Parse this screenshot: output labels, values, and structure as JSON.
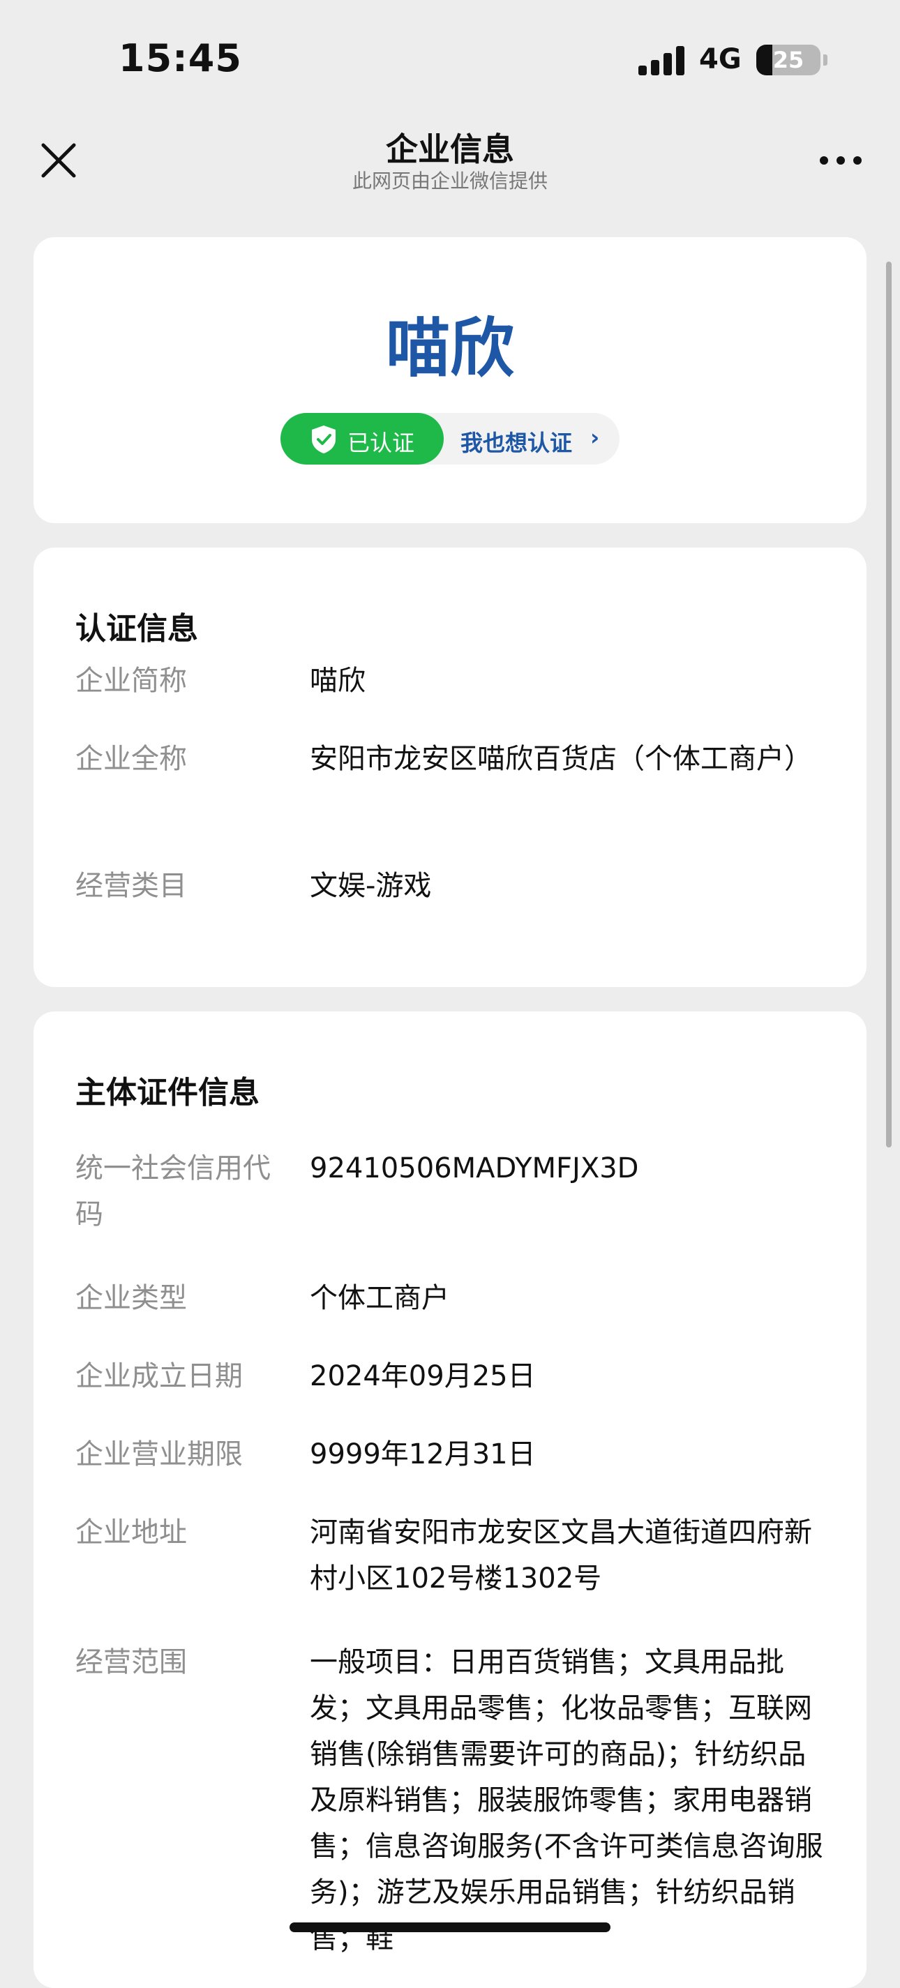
{
  "status": {
    "time": "15:45",
    "network": "4G",
    "battery": "25",
    "battery_level": 0.25
  },
  "nav": {
    "title": "企业信息",
    "subtitle": "此网页由企业微信提供"
  },
  "header_card": {
    "name": "喵欣",
    "badge": "已认证",
    "link": "我也想认证",
    "link_chevron": "›"
  },
  "cert_info": {
    "title": "认证信息",
    "rows": [
      {
        "label": "企业简称",
        "value": "喵欣"
      },
      {
        "label": "企业全称",
        "value": "安阳市龙安区喵欣百货店（个体工商户）"
      },
      {
        "label": "经营类目",
        "value": "文娱-游戏"
      }
    ]
  },
  "entity_info": {
    "title": "主体证件信息",
    "rows": [
      {
        "label": "统一社会信用代码",
        "value": "92410506MADYMFJX3D"
      },
      {
        "label": "企业类型",
        "value": "个体工商户"
      },
      {
        "label": "企业成立日期",
        "value": "2024年09月25日"
      },
      {
        "label": "企业营业期限",
        "value": "9999年12月31日"
      },
      {
        "label": "企业地址",
        "value": "河南省安阳市龙安区文昌大道街道四府新村小区102号楼1302号"
      },
      {
        "label": "经营范围",
        "value": "一般项目：日用百货销售；文具用品批发；文具用品零售；化妆品零售；互联网销售(除销售需要许可的商品)；针纺织品及原料销售；服装服饰零售；家用电器销售；信息咨询服务(不含许可类信息咨询服务)；游艺及娱乐用品销售；针纺织品销售；鞋"
      }
    ]
  },
  "icons": {
    "close": "close-icon",
    "more": "more-icon",
    "shield": "shield-check-icon"
  },
  "colors": {
    "accent": "#1d57a6",
    "verified": "#1fb94a",
    "label": "#8f8f8f",
    "background": "#ededed"
  }
}
